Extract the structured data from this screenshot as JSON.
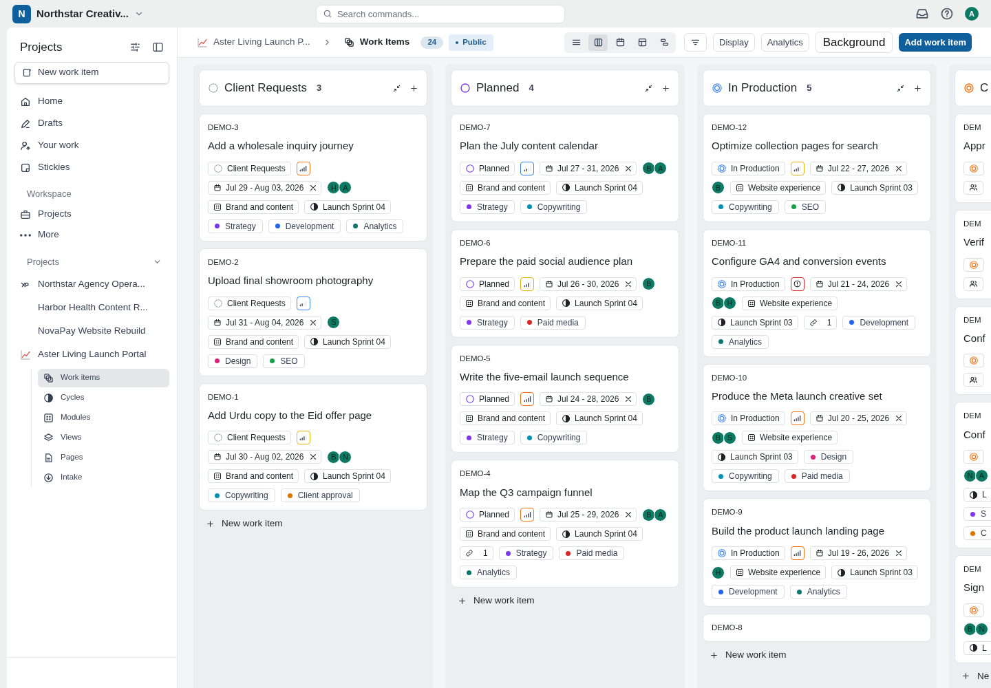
{
  "topbar": {
    "workspace_initial": "N",
    "workspace_name": "Northstar Creativ...",
    "search": {
      "placeholder": "Search commands..."
    },
    "user_initial": "A"
  },
  "sidebar": {
    "title": "Projects",
    "new_item": "New work item",
    "nav": [
      {
        "label": "Home"
      },
      {
        "label": "Drafts"
      },
      {
        "label": "Your work"
      },
      {
        "label": "Stickies"
      }
    ],
    "workspace_heading": "Workspace",
    "workspace_items": [
      {
        "label": "Projects"
      },
      {
        "label": "More"
      }
    ],
    "projects_heading": "Projects",
    "projects": [
      {
        "label": "Northstar Agency Opera..."
      },
      {
        "label": "Harbor Health Content R..."
      },
      {
        "label": "NovaPay Website Rebuild"
      },
      {
        "label": "Aster Living Launch Portal",
        "children": [
          {
            "label": "Work items",
            "selected": true
          },
          {
            "label": "Cycles",
            "selected": false
          },
          {
            "label": "Modules",
            "selected": false
          },
          {
            "label": "Views",
            "selected": false
          },
          {
            "label": "Pages",
            "selected": false
          },
          {
            "label": "Intake",
            "selected": false
          }
        ]
      }
    ]
  },
  "header": {
    "project": "Aster Living Launch P...",
    "page": "Work Items",
    "count": "24",
    "visibility": "Public",
    "layouts": [
      {
        "kind": "list",
        "selected": false
      },
      {
        "kind": "kanban",
        "selected": true
      },
      {
        "kind": "calendar",
        "selected": false
      },
      {
        "kind": "spreadsheet",
        "selected": false
      },
      {
        "kind": "gantt",
        "selected": false
      }
    ],
    "buttons": [
      {
        "label": "Display",
        "kind": "outline"
      },
      {
        "label": "Analytics",
        "kind": "outline"
      },
      {
        "label": "Background",
        "kind": "large"
      },
      {
        "label": "Add work item",
        "kind": "primary"
      }
    ]
  },
  "columns": [
    {
      "title": "Client Requests",
      "kind": "backlog",
      "count": "3",
      "new_item": "New work item",
      "cards": [
        {
          "id": "DEMO-3",
          "title": "Add a wholesale inquiry journey",
          "props": [
            {
              "kind": "backlog",
              "text": "Client Requests"
            },
            {
              "kind": "high"
            },
            {
              "kind": "date",
              "text": "Jul 29 - Aug 03, 2026"
            },
            {
              "kind": "assignees",
              "initials": [
                "H",
                "A"
              ]
            },
            {
              "kind": "module",
              "text": "Brand and content"
            },
            {
              "kind": "cycle",
              "text": "Launch Sprint 04"
            },
            {
              "kind": "label",
              "text": "Strategy",
              "color": "#7c3aed"
            },
            {
              "kind": "label",
              "text": "Development",
              "color": "#2563eb"
            },
            {
              "kind": "label",
              "text": "Analytics",
              "color": "#0f766e"
            }
          ]
        },
        {
          "id": "DEMO-2",
          "title": "Upload final showroom photography",
          "props": [
            {
              "kind": "backlog",
              "text": "Client Requests"
            },
            {
              "kind": "low"
            },
            {
              "kind": "date",
              "text": "Jul 31 - Aug 04, 2026"
            },
            {
              "kind": "assignees",
              "initials": [
                "S"
              ]
            },
            {
              "kind": "module",
              "text": "Brand and content"
            },
            {
              "kind": "cycle",
              "text": "Launch Sprint 04"
            },
            {
              "kind": "label",
              "text": "Design",
              "color": "#db2777"
            },
            {
              "kind": "label",
              "text": "SEO",
              "color": "#16a34a"
            }
          ]
        },
        {
          "id": "DEMO-1",
          "title": "Add Urdu copy to the Eid offer page",
          "props": [
            {
              "kind": "backlog",
              "text": "Client Requests"
            },
            {
              "kind": "medium"
            },
            {
              "kind": "date",
              "text": "Jul 30 - Aug 02, 2026"
            },
            {
              "kind": "assignees",
              "initials": [
                "B",
                "N"
              ]
            },
            {
              "kind": "module",
              "text": "Brand and content"
            },
            {
              "kind": "cycle",
              "text": "Launch Sprint 04"
            },
            {
              "kind": "label",
              "text": "Copywriting",
              "color": "#0891b2"
            },
            {
              "kind": "label",
              "text": "Client approval",
              "color": "#d97706"
            }
          ]
        }
      ]
    },
    {
      "title": "Planned",
      "kind": "unstarted",
      "count": "4",
      "new_item": "New work item",
      "cards": [
        {
          "id": "DEMO-7",
          "title": "Plan the July content calendar",
          "props": [
            {
              "kind": "unstarted",
              "text": "Planned"
            },
            {
              "kind": "low"
            },
            {
              "kind": "date",
              "text": "Jul 27 - 31, 2026"
            },
            {
              "kind": "assignees",
              "initials": [
                "B",
                "A"
              ]
            },
            {
              "kind": "module",
              "text": "Brand and content"
            },
            {
              "kind": "cycle",
              "text": "Launch Sprint 04"
            },
            {
              "kind": "label",
              "text": "Strategy",
              "color": "#7c3aed"
            },
            {
              "kind": "label",
              "text": "Copywriting",
              "color": "#0891b2"
            }
          ]
        },
        {
          "id": "DEMO-6",
          "title": "Prepare the paid social audience plan",
          "props": [
            {
              "kind": "unstarted",
              "text": "Planned"
            },
            {
              "kind": "medium"
            },
            {
              "kind": "date",
              "text": "Jul 26 - 30, 2026"
            },
            {
              "kind": "assignees",
              "initials": [
                "B"
              ]
            },
            {
              "kind": "module",
              "text": "Brand and content"
            },
            {
              "kind": "cycle",
              "text": "Launch Sprint 04"
            },
            {
              "kind": "label",
              "text": "Strategy",
              "color": "#7c3aed"
            },
            {
              "kind": "label",
              "text": "Paid media",
              "color": "#dc2626"
            }
          ]
        },
        {
          "id": "DEMO-5",
          "title": "Write the five-email launch sequence",
          "props": [
            {
              "kind": "unstarted",
              "text": "Planned"
            },
            {
              "kind": "high"
            },
            {
              "kind": "date",
              "text": "Jul 24 - 28, 2026"
            },
            {
              "kind": "assignees",
              "initials": [
                "B"
              ]
            },
            {
              "kind": "module",
              "text": "Brand and content"
            },
            {
              "kind": "cycle",
              "text": "Launch Sprint 04"
            },
            {
              "kind": "label",
              "text": "Strategy",
              "color": "#7c3aed"
            },
            {
              "kind": "label",
              "text": "Copywriting",
              "color": "#0891b2"
            }
          ]
        },
        {
          "id": "DEMO-4",
          "title": "Map the Q3 campaign funnel",
          "props": [
            {
              "kind": "unstarted",
              "text": "Planned"
            },
            {
              "kind": "high"
            },
            {
              "kind": "date",
              "text": "Jul 25 - 29, 2026"
            },
            {
              "kind": "assignees",
              "initials": [
                "B",
                "A"
              ]
            },
            {
              "kind": "module",
              "text": "Brand and content"
            },
            {
              "kind": "cycle",
              "text": "Launch Sprint 04"
            },
            {
              "kind": "links",
              "text": "1"
            },
            {
              "kind": "label",
              "text": "Strategy",
              "color": "#7c3aed"
            },
            {
              "kind": "label",
              "text": "Paid media",
              "color": "#dc2626"
            },
            {
              "kind": "label",
              "text": "Analytics",
              "color": "#0f766e"
            }
          ]
        }
      ]
    },
    {
      "title": "In Production",
      "kind": "started",
      "count": "5",
      "new_item": "New work item",
      "cards": [
        {
          "id": "DEMO-12",
          "title": "Optimize collection pages for search",
          "props": [
            {
              "kind": "started",
              "text": "In Production"
            },
            {
              "kind": "medium"
            },
            {
              "kind": "date",
              "text": "Jul 22 - 27, 2026"
            },
            {
              "kind": "assignees",
              "initials": [
                "B"
              ]
            },
            {
              "kind": "module",
              "text": "Website experience"
            },
            {
              "kind": "cycle",
              "text": "Launch Sprint 03"
            },
            {
              "kind": "label",
              "text": "Copywriting",
              "color": "#0891b2"
            },
            {
              "kind": "label",
              "text": "SEO",
              "color": "#16a34a"
            }
          ]
        },
        {
          "id": "DEMO-11",
          "title": "Configure GA4 and conversion events",
          "props": [
            {
              "kind": "started",
              "text": "In Production"
            },
            {
              "kind": "urgent"
            },
            {
              "kind": "date",
              "text": "Jul 21 - 24, 2026"
            },
            {
              "kind": "assignees",
              "initials": [
                "B",
                "H"
              ]
            },
            {
              "kind": "module",
              "text": "Website experience"
            },
            {
              "kind": "cycle",
              "text": "Launch Sprint 03"
            },
            {
              "kind": "links",
              "text": "1"
            },
            {
              "kind": "label",
              "text": "Development",
              "color": "#2563eb"
            },
            {
              "kind": "label",
              "text": "Analytics",
              "color": "#0f766e"
            }
          ]
        },
        {
          "id": "DEMO-10",
          "title": "Produce the Meta launch creative set",
          "props": [
            {
              "kind": "started",
              "text": "In Production"
            },
            {
              "kind": "high"
            },
            {
              "kind": "date",
              "text": "Jul 20 - 25, 2026"
            },
            {
              "kind": "assignees",
              "initials": [
                "B",
                "S"
              ]
            },
            {
              "kind": "module",
              "text": "Website experience"
            },
            {
              "kind": "cycle",
              "text": "Launch Sprint 03"
            },
            {
              "kind": "label",
              "text": "Design",
              "color": "#db2777"
            },
            {
              "kind": "label",
              "text": "Copywriting",
              "color": "#0891b2"
            },
            {
              "kind": "label",
              "text": "Paid media",
              "color": "#dc2626"
            }
          ]
        },
        {
          "id": "DEMO-9",
          "title": "Build the product launch landing page",
          "props": [
            {
              "kind": "started",
              "text": "In Production"
            },
            {
              "kind": "high"
            },
            {
              "kind": "date",
              "text": "Jul 19 - 26, 2026"
            },
            {
              "kind": "assignees",
              "initials": [
                "H"
              ]
            },
            {
              "kind": "module",
              "text": "Website experience"
            },
            {
              "kind": "cycle",
              "text": "Launch Sprint 03"
            },
            {
              "kind": "label",
              "text": "Development",
              "color": "#2563eb"
            },
            {
              "kind": "label",
              "text": "Analytics",
              "color": "#0f766e"
            }
          ]
        },
        {
          "id": "DEMO-8"
        }
      ]
    },
    {
      "title": "C",
      "kind": "review",
      "clipped": true,
      "new_item": "Ne",
      "cards": [
        {
          "id": "DEM",
          "title": "Appr",
          "props": [
            {
              "kind": "review"
            },
            {
              "kind": "members"
            }
          ]
        },
        {
          "id": "DEM",
          "title": "Verif",
          "props": [
            {
              "kind": "review"
            },
            {
              "kind": "members"
            }
          ]
        },
        {
          "id": "DEM",
          "title": "Conf",
          "props": [
            {
              "kind": "review"
            },
            {
              "kind": "members"
            }
          ]
        },
        {
          "id": "DEM",
          "title": "Conf",
          "props": [
            {
              "kind": "review"
            },
            {
              "kind": "assignees",
              "initials": [
                "N",
                "A"
              ]
            },
            {
              "kind": "cycle",
              "text": "L"
            },
            {
              "kind": "label",
              "text": "S",
              "color": "#7c3aed"
            },
            {
              "kind": "label",
              "text": "C",
              "color": "#d97706"
            }
          ]
        },
        {
          "id": "DEM",
          "title": "Sign",
          "props": [
            {
              "kind": "review"
            },
            {
              "kind": "assignees",
              "initials": [
                "B",
                "N"
              ]
            },
            {
              "kind": "cycle",
              "text": "L"
            }
          ]
        }
      ]
    }
  ]
}
